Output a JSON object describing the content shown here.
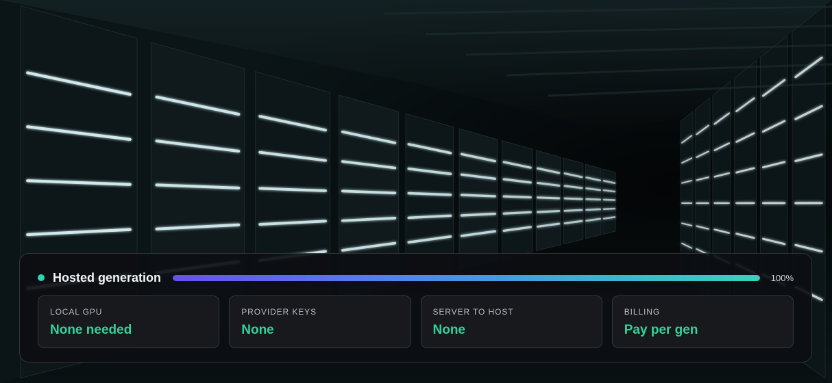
{
  "panel": {
    "title": "Hosted generation",
    "progress": 1.0,
    "progress_label": "100%",
    "cards": [
      {
        "label": "LOCAL GPU",
        "value": "None needed"
      },
      {
        "label": "PROVIDER KEYS",
        "value": "None"
      },
      {
        "label": "SERVER TO HOST",
        "value": "None"
      },
      {
        "label": "BILLING",
        "value": "Pay per gen"
      }
    ]
  },
  "colors": {
    "accent": "#34d399",
    "status_dot": "#2fd3b7",
    "gradient_start": "#6a4ff2",
    "gradient_end": "#34d3bb",
    "background": "#05080a"
  },
  "icons": {
    "status": "status-dot-icon"
  }
}
